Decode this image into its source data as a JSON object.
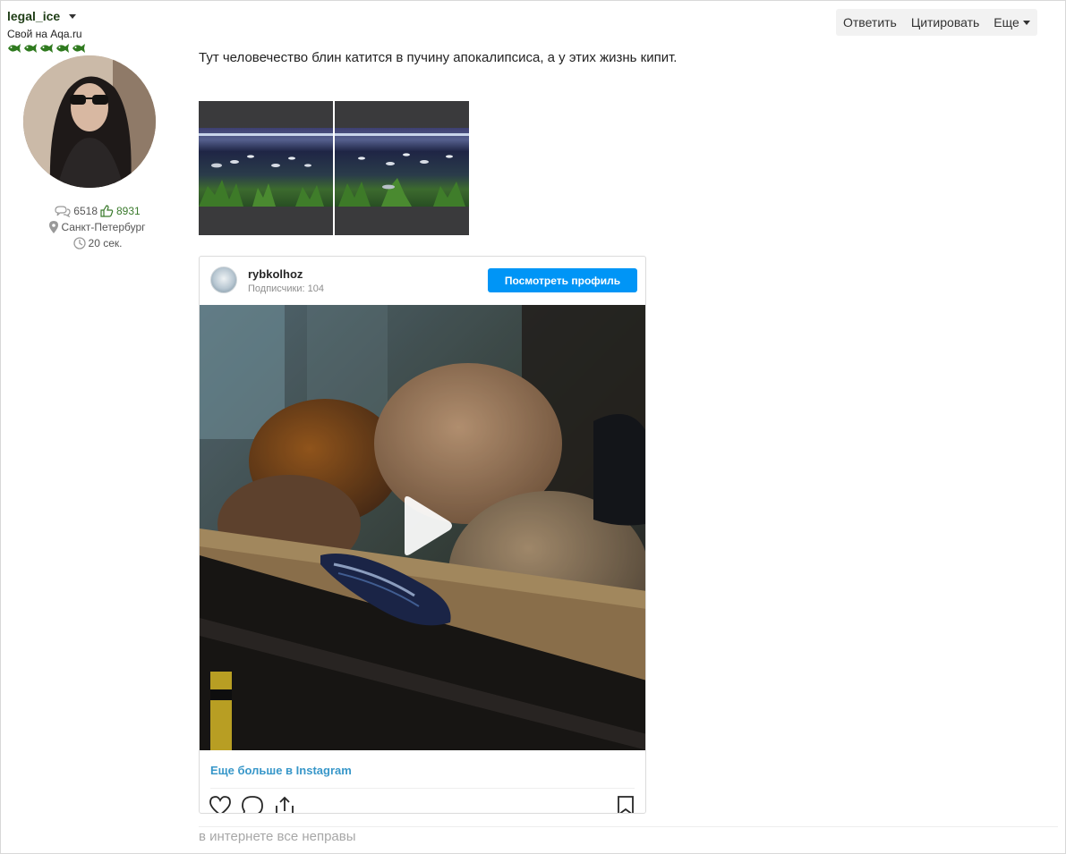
{
  "author": {
    "name": "legal_ice",
    "rank": "Свой на Aqa.ru",
    "fish_count": 5,
    "fish_color": "#2f7a1f",
    "posts": "6518",
    "likes": "8931",
    "location": "Санкт-Петербург",
    "last_seen": "20 сек."
  },
  "actions": {
    "reply": "Ответить",
    "quote": "Цитировать",
    "more": "Еще"
  },
  "post": {
    "text": "Тут человечество блин катится в пучину апокалипсиса, а у этих жизнь кипит."
  },
  "instagram": {
    "username": "rybkolhoz",
    "followers": "Подписчики: 104",
    "view_profile": "Посмотреть профиль",
    "more_link": "Еще больше в Instagram",
    "button_color": "#0095f6"
  },
  "signature": "в интернете все неправы"
}
